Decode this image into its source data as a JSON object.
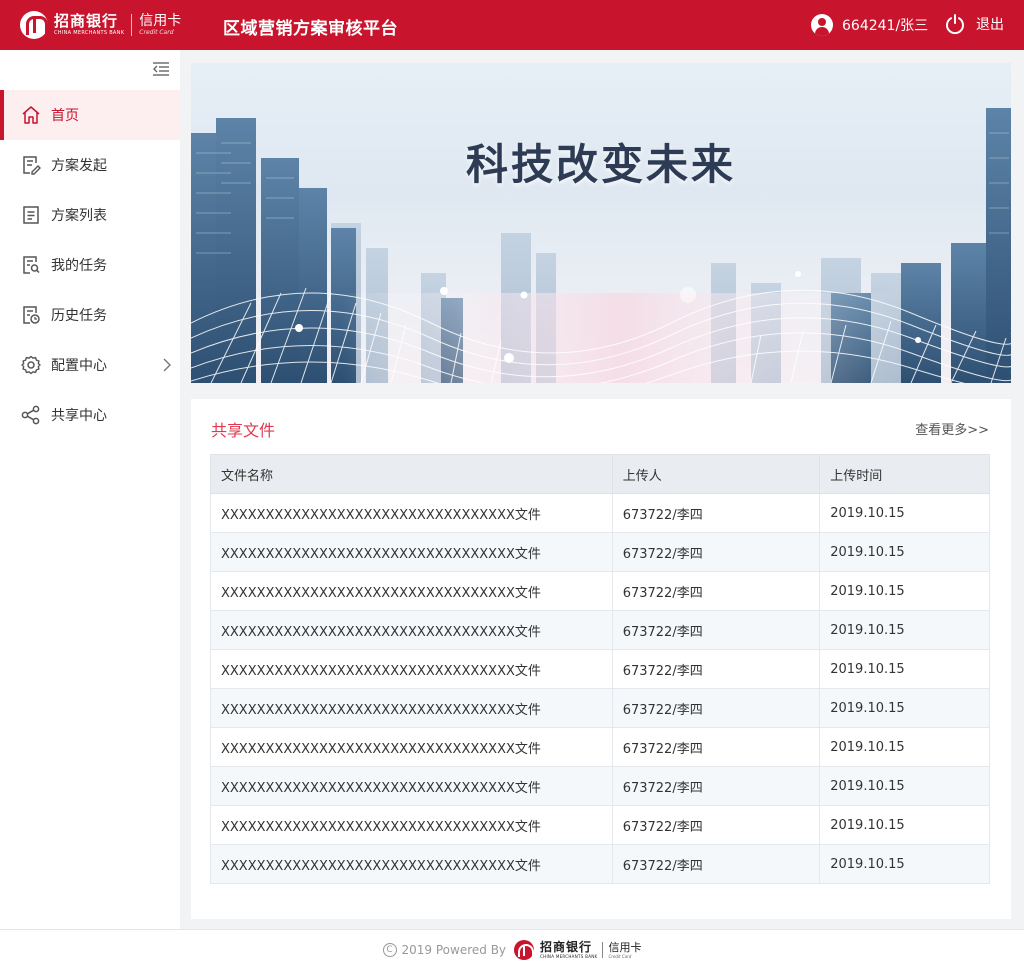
{
  "header": {
    "brand_cn": "招商银行",
    "brand_en": "CHINA MERCHANTS BANK",
    "card_cn": "信用卡",
    "card_en": "Credit Card",
    "app_title": "区域营销方案审核平台",
    "user": "664241/张三",
    "logout_label": "退出",
    "colors": {
      "brand_red": "#c8142d"
    }
  },
  "sidebar": {
    "items": [
      {
        "label": "首页",
        "icon": "home-icon",
        "active": true
      },
      {
        "label": "方案发起",
        "icon": "edit-document-icon"
      },
      {
        "label": "方案列表",
        "icon": "list-document-icon"
      },
      {
        "label": "我的任务",
        "icon": "task-search-icon"
      },
      {
        "label": "历史任务",
        "icon": "history-document-icon"
      },
      {
        "label": "配置中心",
        "icon": "gear-icon",
        "has_submenu": true
      },
      {
        "label": "共享中心",
        "icon": "share-icon"
      }
    ]
  },
  "banner": {
    "title": "科技改变未来"
  },
  "shared_files": {
    "title": "共享文件",
    "more_link": "查看更多>>",
    "columns": [
      "文件名称",
      "上传人",
      "上传时间"
    ],
    "rows": [
      [
        "XXXXXXXXXXXXXXXXXXXXXXXXXXXXXXXXX文件",
        "673722/李四",
        "2019.10.15"
      ],
      [
        "XXXXXXXXXXXXXXXXXXXXXXXXXXXXXXXXX文件",
        "673722/李四",
        "2019.10.15"
      ],
      [
        "XXXXXXXXXXXXXXXXXXXXXXXXXXXXXXXXX文件",
        "673722/李四",
        "2019.10.15"
      ],
      [
        "XXXXXXXXXXXXXXXXXXXXXXXXXXXXXXXXX文件",
        "673722/李四",
        "2019.10.15"
      ],
      [
        "XXXXXXXXXXXXXXXXXXXXXXXXXXXXXXXXX文件",
        "673722/李四",
        "2019.10.15"
      ],
      [
        "XXXXXXXXXXXXXXXXXXXXXXXXXXXXXXXXX文件",
        "673722/李四",
        "2019.10.15"
      ],
      [
        "XXXXXXXXXXXXXXXXXXXXXXXXXXXXXXXXX文件",
        "673722/李四",
        "2019.10.15"
      ],
      [
        "XXXXXXXXXXXXXXXXXXXXXXXXXXXXXXXXX文件",
        "673722/李四",
        "2019.10.15"
      ],
      [
        "XXXXXXXXXXXXXXXXXXXXXXXXXXXXXXXXX文件",
        "673722/李四",
        "2019.10.15"
      ],
      [
        "XXXXXXXXXXXXXXXXXXXXXXXXXXXXXXXXX文件",
        "673722/李四",
        "2019.10.15"
      ]
    ]
  },
  "footer": {
    "copyright_symbol": "C",
    "text": "2019 Powered By",
    "brand_cn": "招商银行",
    "brand_en": "CHINA MERCHANTS BANK",
    "card_cn": "信用卡",
    "card_en": "Credit Card"
  }
}
